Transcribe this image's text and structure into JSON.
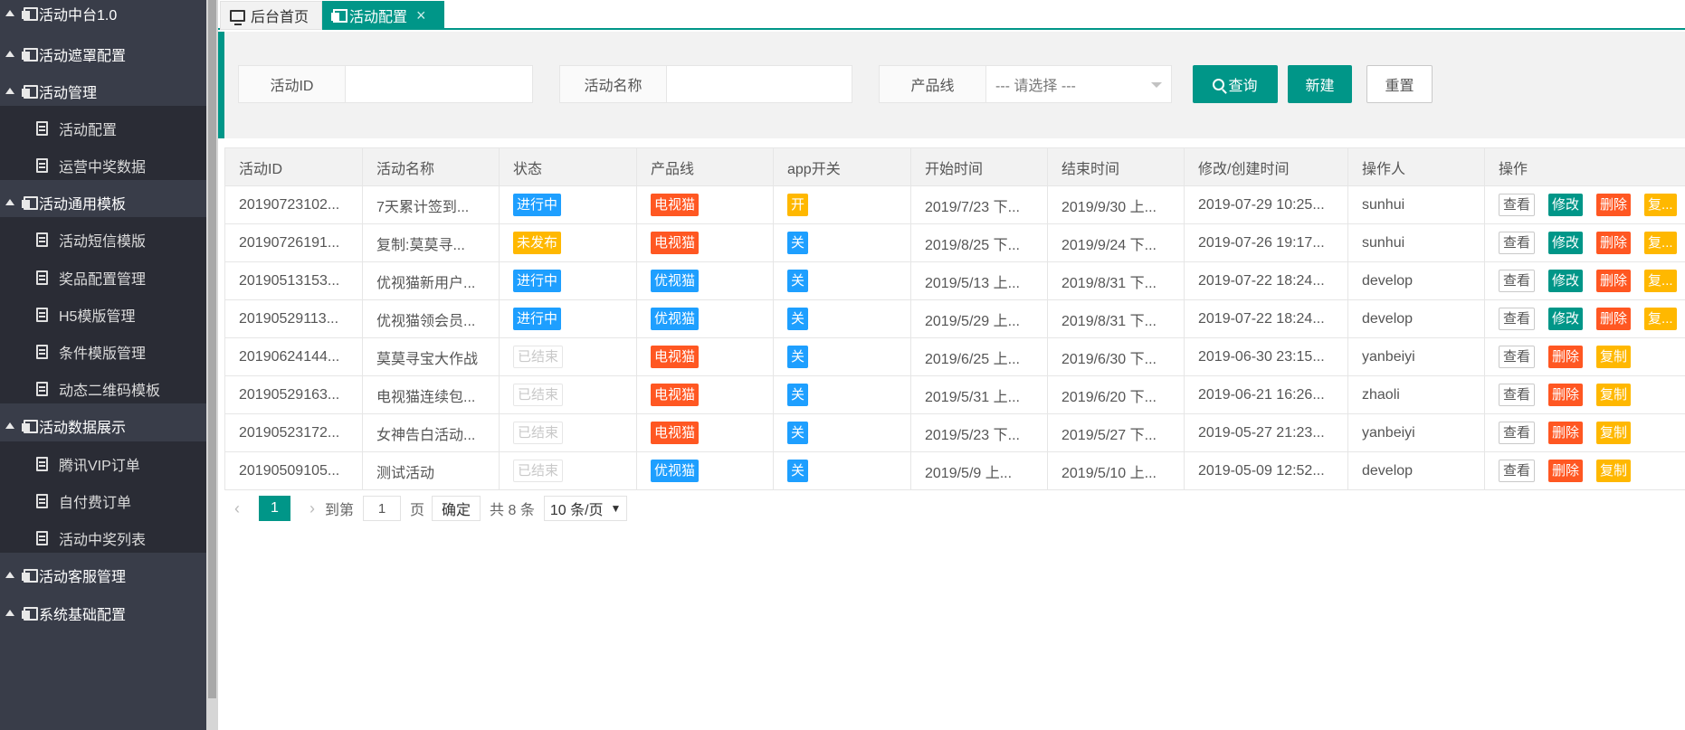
{
  "sidebar": {
    "items": [
      {
        "label": "活动中台1.0",
        "type": "group"
      },
      {
        "label": "活动遮罩配置",
        "type": "group"
      },
      {
        "label": "活动管理",
        "type": "group"
      },
      {
        "label": "活动配置",
        "type": "child"
      },
      {
        "label": "运营中奖数据",
        "type": "child"
      },
      {
        "label": "活动通用模板",
        "type": "group"
      },
      {
        "label": "活动短信模版",
        "type": "child"
      },
      {
        "label": "奖品配置管理",
        "type": "child"
      },
      {
        "label": "H5模版管理",
        "type": "child"
      },
      {
        "label": "条件模版管理",
        "type": "child"
      },
      {
        "label": "动态二维码模板",
        "type": "child"
      },
      {
        "label": "活动数据展示",
        "type": "group"
      },
      {
        "label": "腾讯VIP订单",
        "type": "child"
      },
      {
        "label": "自付费订单",
        "type": "child"
      },
      {
        "label": "活动中奖列表",
        "type": "child"
      },
      {
        "label": "活动客服管理",
        "type": "group"
      },
      {
        "label": "系统基础配置",
        "type": "group"
      }
    ]
  },
  "tabs": {
    "home": "后台首页",
    "active": "活动配置",
    "close": "×"
  },
  "filters": {
    "activity_id_label": "活动ID",
    "activity_id_value": "",
    "activity_name_label": "活动名称",
    "activity_name_value": "",
    "product_line_label": "产品线",
    "product_line_selected": "--- 请选择 ---",
    "query_button": "查询",
    "new_button": "新建",
    "reset_button": "重置"
  },
  "table": {
    "columns": [
      "活动ID",
      "活动名称",
      "状态",
      "产品线",
      "app开关",
      "开始时间",
      "结束时间",
      "修改/创建时间",
      "操作人",
      "操作"
    ],
    "rows": [
      {
        "id": "20190723102...",
        "name": "7天累计签到...",
        "status": "进行中",
        "status_kind": "blue",
        "product": "电视猫",
        "product_kind": "red",
        "app": "开",
        "app_kind": "kai",
        "start": "2019/7/23 下...",
        "end": "2019/9/30 上...",
        "modified": "2019-07-29 10:25...",
        "operator": "sunhui",
        "ops": [
          "查看",
          "修改",
          "删除",
          "复..."
        ]
      },
      {
        "id": "20190726191...",
        "name": "复制:莫莫寻...",
        "status": "未发布",
        "status_kind": "yellow",
        "product": "电视猫",
        "product_kind": "red",
        "app": "关",
        "app_kind": "blue",
        "start": "2019/8/25 下...",
        "end": "2019/9/24 下...",
        "modified": "2019-07-26 19:17...",
        "operator": "sunhui",
        "ops": [
          "查看",
          "修改",
          "删除",
          "复..."
        ]
      },
      {
        "id": "20190513153...",
        "name": "优视猫新用户...",
        "status": "进行中",
        "status_kind": "blue",
        "product": "优视猫",
        "product_kind": "blue",
        "app": "关",
        "app_kind": "blue",
        "start": "2019/5/13 上...",
        "end": "2019/8/31 下...",
        "modified": "2019-07-22 18:24...",
        "operator": "develop",
        "ops": [
          "查看",
          "修改",
          "删除",
          "复..."
        ]
      },
      {
        "id": "20190529113...",
        "name": "优视猫领会员...",
        "status": "进行中",
        "status_kind": "blue",
        "product": "优视猫",
        "product_kind": "blue",
        "app": "关",
        "app_kind": "blue",
        "start": "2019/5/29 上...",
        "end": "2019/8/31 下...",
        "modified": "2019-07-22 18:24...",
        "operator": "develop",
        "ops": [
          "查看",
          "修改",
          "删除",
          "复..."
        ]
      },
      {
        "id": "20190624144...",
        "name": "莫莫寻宝大作战",
        "status": "已结束",
        "status_kind": "gray",
        "product": "电视猫",
        "product_kind": "red",
        "app": "关",
        "app_kind": "blue",
        "start": "2019/6/25 上...",
        "end": "2019/6/30 下...",
        "modified": "2019-06-30 23:15...",
        "operator": "yanbeiyi",
        "ops": [
          "查看",
          "删除",
          "复制"
        ]
      },
      {
        "id": "20190529163...",
        "name": "电视猫连续包...",
        "status": "已结束",
        "status_kind": "gray",
        "product": "电视猫",
        "product_kind": "red",
        "app": "关",
        "app_kind": "blue",
        "start": "2019/5/31 上...",
        "end": "2019/6/20 下...",
        "modified": "2019-06-21 16:26...",
        "operator": "zhaoli",
        "ops": [
          "查看",
          "删除",
          "复制"
        ]
      },
      {
        "id": "20190523172...",
        "name": "女神告白活动...",
        "status": "已结束",
        "status_kind": "gray",
        "product": "电视猫",
        "product_kind": "red",
        "app": "关",
        "app_kind": "blue",
        "start": "2019/5/23 下...",
        "end": "2019/5/27 下...",
        "modified": "2019-05-27 21:23...",
        "operator": "yanbeiyi",
        "ops": [
          "查看",
          "删除",
          "复制"
        ]
      },
      {
        "id": "20190509105...",
        "name": "测试活动",
        "status": "已结束",
        "status_kind": "gray",
        "product": "优视猫",
        "product_kind": "blue",
        "app": "关",
        "app_kind": "blue",
        "start": "2019/5/9 上...",
        "end": "2019/5/10 上...",
        "modified": "2019-05-09 12:52...",
        "operator": "develop",
        "ops": [
          "查看",
          "删除",
          "复制"
        ]
      }
    ]
  },
  "pager": {
    "prev": "‹",
    "current": "1",
    "next": "›",
    "goto_label": "到第",
    "goto_value": "1",
    "page_unit": "页",
    "confirm": "确定",
    "total": "共 8 条",
    "page_size": "10 条/页",
    "page_size_arrow": "▼"
  },
  "colors": {
    "accent": "#009688",
    "sidebar_bg": "#393d49",
    "danger": "#ff5722",
    "warn": "#ffb800",
    "info": "#1e9fff"
  }
}
